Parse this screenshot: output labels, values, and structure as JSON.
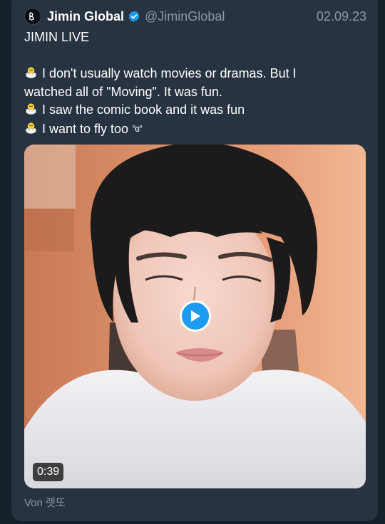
{
  "author": {
    "display_name": "Jimin Global",
    "handle": "@JiminGlobal",
    "avatar_icon": "jimin-logo-icon",
    "verified": true
  },
  "date": "02.09.23",
  "tweet": {
    "title": "JIMIN LIVE",
    "line1a": "I don't usually watch movies or dramas. But I",
    "line1b": "watched all of \"Moving\". It was fun.",
    "line2": "I saw the comic book and it was fun",
    "line3": "I want to fly too",
    "line3_emoticon": "°ɞ°"
  },
  "media": {
    "duration": "0:39",
    "play_icon": "play-icon"
  },
  "source": "Von 렛또",
  "colors": {
    "background": "#15202b",
    "card": "#273340",
    "accent": "#1d9bf0",
    "muted": "#8b98a5"
  }
}
